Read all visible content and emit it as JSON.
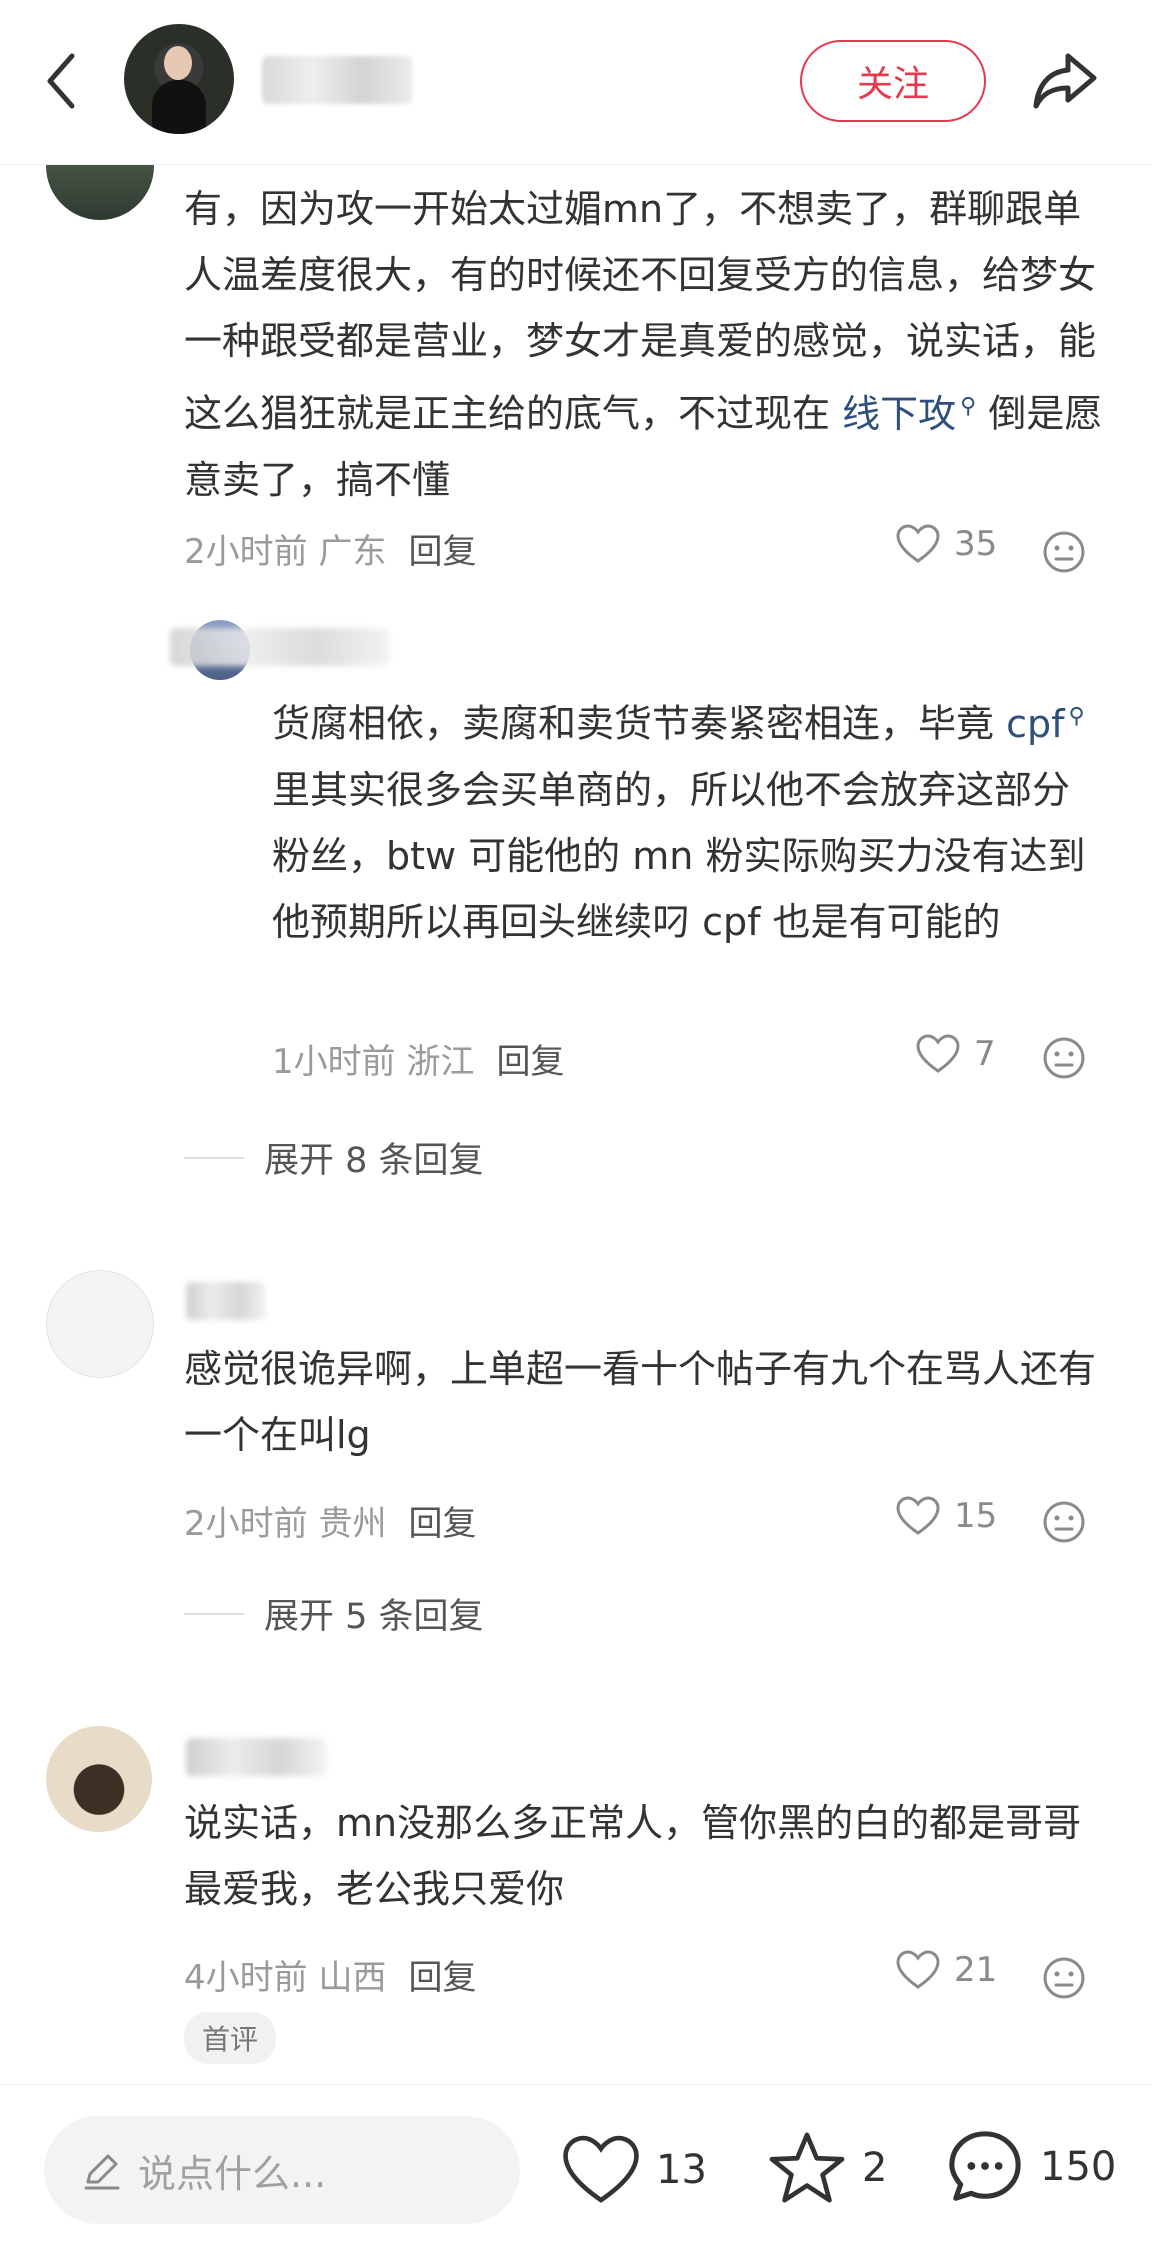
{
  "header": {
    "follow_label": "关注"
  },
  "comments": [
    {
      "text_part1": "有，因为攻一开始太过媚mn了，不想卖了，群聊跟单人温差度很大，有的时候还不回复受方的信息，给梦女一种跟受都是营业，梦女才是真爱的感觉，说实话，能这么猖狂就是正主给的底气，不过现在 ",
      "link_text": "线下攻",
      "text_part2": " 倒是愿意卖了，搞不懂",
      "time": "2小时前",
      "location": "广东",
      "reply_label": "回复",
      "likes": "35"
    },
    {
      "text_part1": "货腐相依，卖腐和卖货节奏紧密相连，毕竟 ",
      "link_text": "cpf",
      "text_part2": " 里其实很多会买单商的，所以他不会放弃这部分粉丝，btw 可能他的 mn 粉实际购买力没有达到他预期所以再回头继续叼 cpf 也是有可能的",
      "time": "1小时前",
      "location": "浙江",
      "reply_label": "回复",
      "likes": "7",
      "expand_label": "展开 8 条回复"
    },
    {
      "text": "感觉很诡异啊，上单超一看十个帖子有九个在骂人还有一个在叫lg",
      "time": "2小时前",
      "location": "贵州",
      "reply_label": "回复",
      "likes": "15",
      "expand_label": "展开 5 条回复"
    },
    {
      "text": "说实话，mn没那么多正常人，管你黑的白的都是哥哥最爱我，老公我只爱你",
      "time": "4小时前",
      "location": "山西",
      "reply_label": "回复",
      "likes": "21",
      "badge": "首评"
    }
  ],
  "bottom": {
    "placeholder": "说点什么...",
    "likes": "13",
    "stars": "2",
    "comments": "150"
  },
  "colors": {
    "accent_red": "#e6394b",
    "link_blue": "#2e4f7e",
    "meta_gray": "#9a9a9a"
  },
  "icons": [
    "back-arrow-icon",
    "share-icon",
    "heart-icon",
    "emoji-icon",
    "pencil-icon",
    "star-icon",
    "comment-bubble-icon",
    "search-mag-icon"
  ]
}
